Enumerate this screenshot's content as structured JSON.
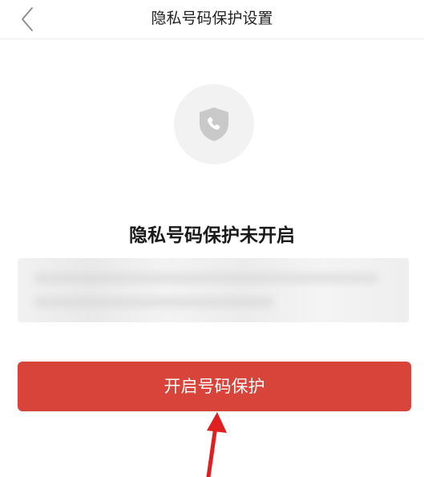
{
  "header": {
    "title": "隐私号码保护设置",
    "back_icon": "chevron-left-icon"
  },
  "status": {
    "icon": "shield-phone-icon",
    "title": "隐私号码保护未开启"
  },
  "actions": {
    "open_button_label": "开启号码保护"
  },
  "annotation": {
    "arrow_icon": "red-arrow-icon",
    "arrow_color": "#e02020"
  },
  "colors": {
    "button": "#d8433a",
    "icon_bg": "#f2f2f2",
    "icon_fg": "#c9c9c9"
  }
}
